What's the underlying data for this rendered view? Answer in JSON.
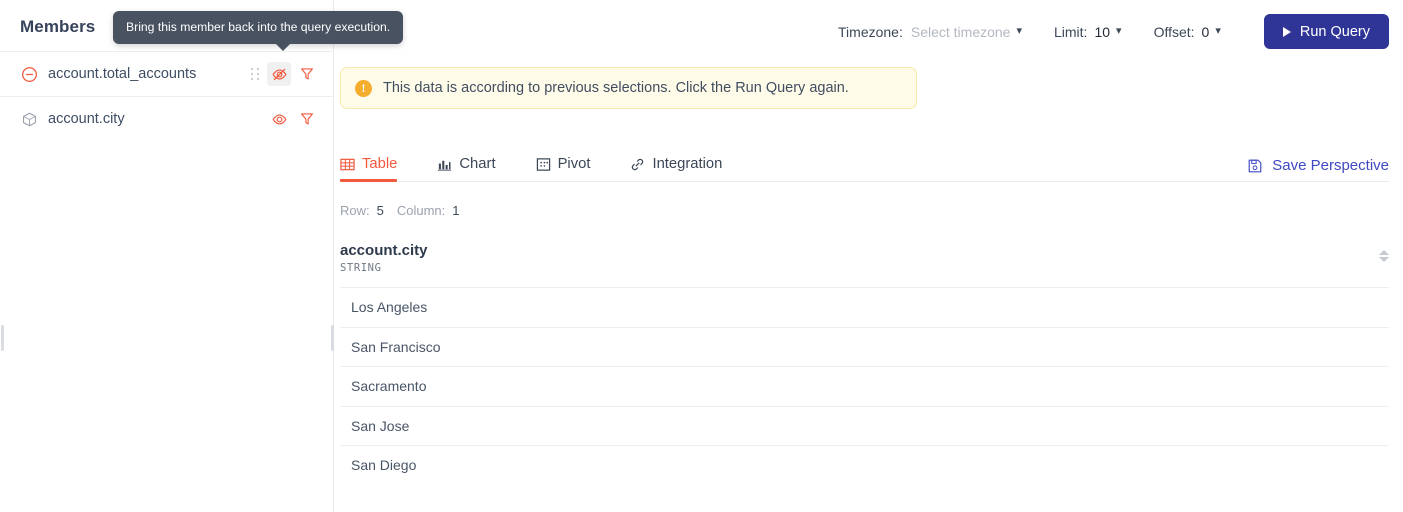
{
  "sidebar": {
    "title": "Members",
    "members": [
      {
        "name": "account.total_accounts",
        "icon": "measure-minus-circle-icon",
        "visibility_icon": "eye-off-icon",
        "filter_icon": "funnel-icon",
        "has_drag_handle": true,
        "hidden": true
      },
      {
        "name": "account.city",
        "icon": "dimension-cube-icon",
        "visibility_icon": "eye-icon",
        "filter_icon": "funnel-icon",
        "has_drag_handle": false,
        "hidden": false
      }
    ]
  },
  "tooltip": {
    "text": "Bring this member back into the query execution."
  },
  "toolbar": {
    "timezone_label": "Timezone:",
    "timezone_placeholder": "Select timezone",
    "limit_label": "Limit:",
    "limit_value": "10",
    "offset_label": "Offset:",
    "offset_value": "0",
    "run_query_label": "Run Query"
  },
  "alert": {
    "icon": "!",
    "message": "This data is according to previous selections. Click the Run Query again."
  },
  "tabs": [
    {
      "label": "Table",
      "icon": "table-grid-icon",
      "active": true
    },
    {
      "label": "Chart",
      "icon": "bar-chart-icon",
      "active": false
    },
    {
      "label": "Pivot",
      "icon": "pivot-icon",
      "active": false
    },
    {
      "label": "Integration",
      "icon": "link-icon",
      "active": false
    }
  ],
  "save_perspective": {
    "label": "Save Perspective",
    "icon": "save-floppy-icon"
  },
  "result_meta": {
    "row_label": "Row:",
    "row_value": "5",
    "column_label": "Column:",
    "column_value": "1"
  },
  "table": {
    "columns": [
      {
        "name": "account.city",
        "type": "STRING"
      }
    ],
    "rows": [
      "Los Angeles",
      "San Francisco",
      "Sacramento",
      "San Jose",
      "San Diego"
    ]
  },
  "colors": {
    "accent_orange": "#f2593d",
    "primary_blue": "#2f3596",
    "link_blue": "#3f49c4",
    "alert_bg": "#fefbe8",
    "alert_border": "#fae9b0",
    "alert_icon": "#f5ad2e",
    "tooltip_bg": "#495260"
  }
}
